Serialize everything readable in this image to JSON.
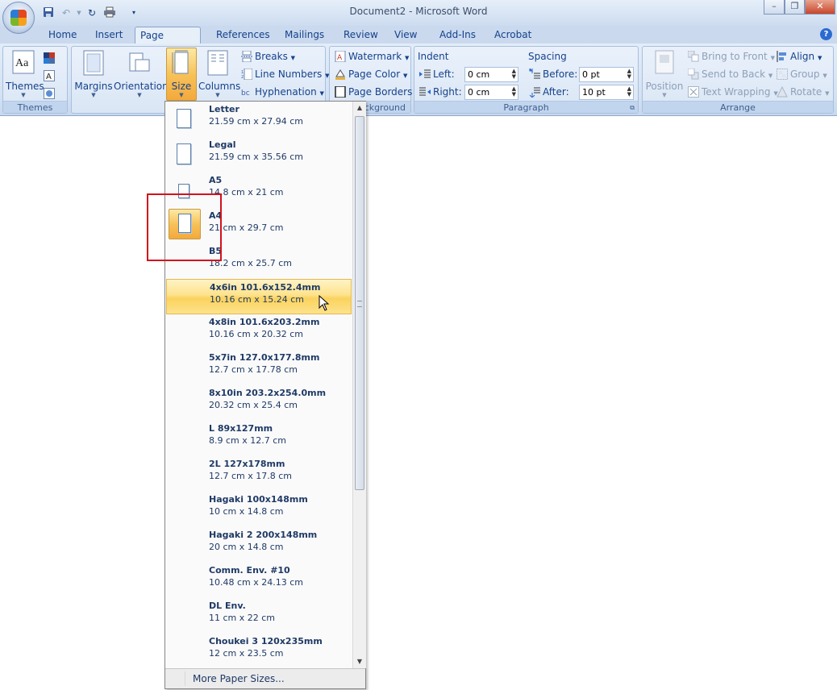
{
  "window": {
    "title": "Document2 - Microsoft Word",
    "minimize_glyph": "–",
    "restore_glyph": "❐",
    "close_glyph": "✕"
  },
  "quick_access": [
    "save-icon",
    "undo-icon",
    "redo-icon",
    "print-icon",
    "customize-icon"
  ],
  "tabs": [
    "Home",
    "Insert",
    "Page Layout",
    "References",
    "Mailings",
    "Review",
    "View",
    "Add-Ins",
    "Acrobat"
  ],
  "active_tab": "Page Layout",
  "help_glyph": "?",
  "ribbon": {
    "themes": {
      "button": "Themes",
      "group": "Themes"
    },
    "page_setup": {
      "margins": "Margins",
      "orientation": "Orientation",
      "size": "Size",
      "columns": "Columns",
      "breaks": "Breaks",
      "line_numbers": "Line Numbers",
      "hyphenation": "Hyphenation"
    },
    "background": {
      "watermark": "Watermark",
      "page_color": "Page Color",
      "page_borders": "Page Borders",
      "group": "ckground"
    },
    "paragraph": {
      "indent_label": "Indent",
      "left_label": "Left:",
      "left_value": "0 cm",
      "right_label": "Right:",
      "right_value": "0 cm",
      "spacing_label": "Spacing",
      "before_label": "Before:",
      "before_value": "0 pt",
      "after_label": "After:",
      "after_value": "10 pt",
      "group": "Paragraph"
    },
    "arrange": {
      "position": "Position",
      "bring_to_front": "Bring to Front",
      "send_to_back": "Send to Back",
      "text_wrapping": "Text Wrapping",
      "align": "Align",
      "group_btn": "Group",
      "rotate": "Rotate",
      "group": "Arrange"
    }
  },
  "size_menu": {
    "items": [
      {
        "name": "Letter",
        "dims": "21.59 cm x 27.94 cm"
      },
      {
        "name": "Legal",
        "dims": "21.59 cm x 35.56 cm"
      },
      {
        "name": "A5",
        "dims": "14.8 cm x 21 cm"
      },
      {
        "name": "A4",
        "dims": "21 cm x 29.7 cm"
      },
      {
        "name": "B5",
        "dims": "18.2 cm x 25.7 cm"
      },
      {
        "name": "4x6in 101.6x152.4mm",
        "dims": "10.16 cm x 15.24 cm"
      },
      {
        "name": "4x8in 101.6x203.2mm",
        "dims": "10.16 cm x 20.32 cm"
      },
      {
        "name": "5x7in 127.0x177.8mm",
        "dims": "12.7 cm x 17.78 cm"
      },
      {
        "name": "8x10in 203.2x254.0mm",
        "dims": "20.32 cm x 25.4 cm"
      },
      {
        "name": "L 89x127mm",
        "dims": "8.9 cm x 12.7 cm"
      },
      {
        "name": "2L 127x178mm",
        "dims": "12.7 cm x 17.8 cm"
      },
      {
        "name": "Hagaki 100x148mm",
        "dims": "10 cm x 14.8 cm"
      },
      {
        "name": "Hagaki 2 200x148mm",
        "dims": "20 cm x 14.8 cm"
      },
      {
        "name": "Comm. Env. #10",
        "dims": "10.48 cm x 24.13 cm"
      },
      {
        "name": "DL Env.",
        "dims": "11 cm x 22 cm"
      },
      {
        "name": "Choukei 3 120x235mm",
        "dims": "12 cm x 23.5 cm"
      }
    ],
    "selected": "A4",
    "hovered": "4x6in 101.6x152.4mm",
    "more": "More Paper Sizes..."
  },
  "colors": {
    "highlight": "#f7c25a",
    "annotation_box": "#d3121c",
    "ribbon_text": "#15428b"
  }
}
